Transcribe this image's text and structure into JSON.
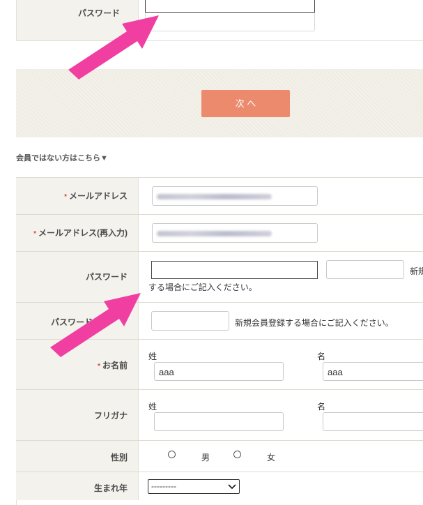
{
  "login": {
    "password_label": "パスワード",
    "password_value": ""
  },
  "next_button_label": "次 へ",
  "non_member_link": "会員ではない方はこちら▼",
  "form": {
    "required_mark": "*",
    "email_label": "メールアドレス",
    "email_confirm_label": "メールアドレス(再入力)",
    "password_label": "パスワード",
    "password_note_start": "新規",
    "password_note_rest": "する場合にご記入ください。",
    "password_confirm_label": "パスワード",
    "password_confirm_note": "新規会員登録する場合にご記入ください。",
    "name_label": "お名前",
    "last_name_label": "姓",
    "first_name_label": "名",
    "last_name_value": "aaa",
    "first_name_value": "aaa",
    "furigana_label": "フリガナ",
    "furigana_last_label": "姓",
    "furigana_first_label": "名",
    "gender_label": "性別",
    "gender_male": "男",
    "gender_female": "女",
    "birth_year_label": "生まれ年",
    "birth_year_selected": "---------"
  },
  "colors": {
    "next_button": "#ec8a6e",
    "panel_bg": "#efece3",
    "label_bg": "#f4f2ec",
    "arrow": "#f03fa0",
    "required": "#d9443a"
  }
}
